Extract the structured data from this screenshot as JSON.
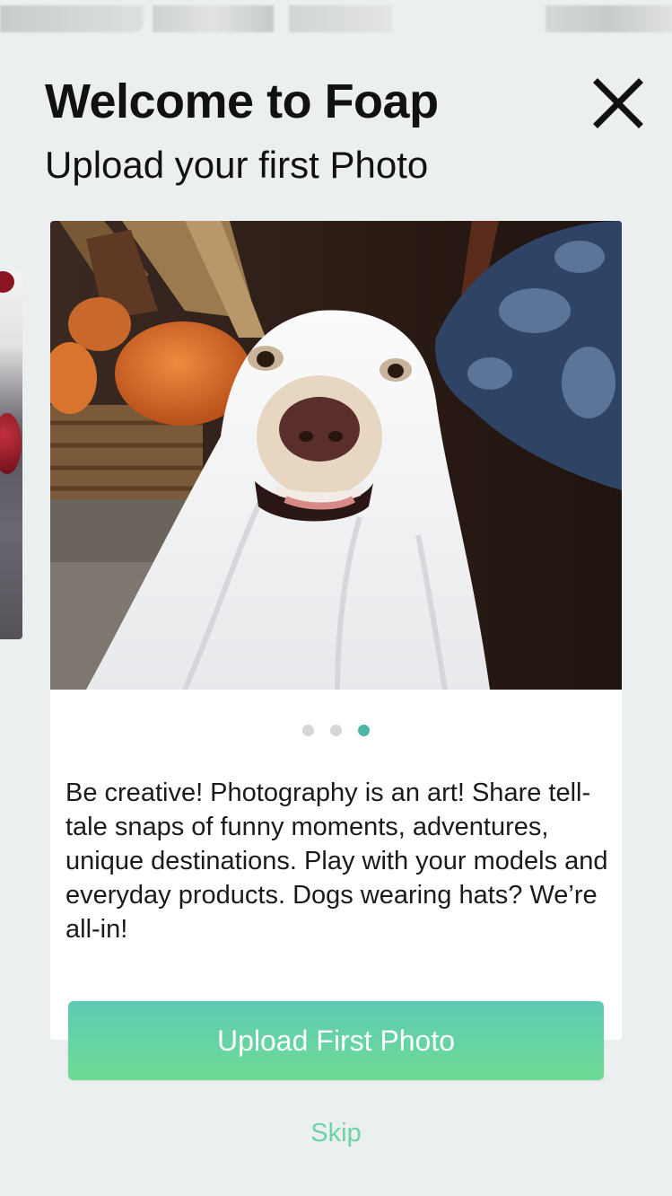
{
  "header": {
    "title": "Welcome to Foap",
    "subtitle": "Upload your first Photo",
    "close_icon": "close-icon"
  },
  "onboarding": {
    "total_slides": 3,
    "active_slide": 3,
    "description": "Be creative! Photography is an art! Share tell-tale snaps of funny moments, adventures, unique destinations. Play with your models and everyday products. Dogs wearing hats? We’re all-in!"
  },
  "actions": {
    "upload_label": "Upload First Photo",
    "skip_label": "Skip"
  },
  "colors": {
    "accent_dot": "#4fb5a5",
    "button_gradient_top": "#5ecab6",
    "button_gradient_bottom": "#6ddc92",
    "skip_text": "#6bd4a6",
    "background": "#ebefef"
  }
}
